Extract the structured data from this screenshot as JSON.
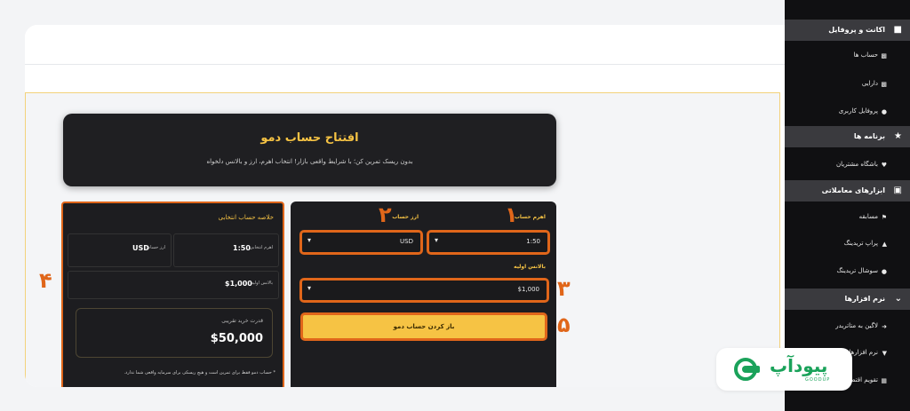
{
  "hero": {
    "title": "افتتاح حساب دمو",
    "subtitle": "بدون ریسک تمرین کن؛ با شرایط واقعی بازار! انتخاب اهرم، ارز و بالانس دلخواه"
  },
  "form": {
    "leverage_label": "اهرم حساب",
    "leverage_value": "1:50",
    "currency_label": "ارز حساب",
    "currency_value": "USD",
    "balance_label": "بالانس اولیه",
    "balance_value": "$1,000",
    "submit_label": "باز کردن حساب دمو"
  },
  "summary": {
    "title": "خلاصه حساب انتخابی",
    "leverage_label": "اهرم انتخابی",
    "leverage_value": "1:50",
    "currency_label": "ارز حساب",
    "currency_value": "USD",
    "balance_label": "بالانس اولیه",
    "balance_value": "$1,000",
    "buying_power_label": "قدرت خرید تقریبی",
    "buying_power_value": "$50,000",
    "note": "* حساب دمو فقط برای تمرین است و هیچ ریسکی برای سرمایه واقعی شما ندارد."
  },
  "annotations": {
    "n1": "۱",
    "n2": "۲",
    "n3": "۳",
    "n4": "۴",
    "n5": "۵"
  },
  "sidebar": {
    "sections": [
      {
        "title": "اکانت و پروفایل",
        "icon": "user-icon",
        "items": [
          {
            "label": "حساب ها",
            "icon": "wallet-icon"
          },
          {
            "label": "دارایی",
            "icon": "card-icon"
          },
          {
            "label": "پروفایل کاربری",
            "icon": "user-icon"
          }
        ]
      },
      {
        "title": "برنامه ها",
        "icon": "trophy-icon",
        "items": [
          {
            "label": "باشگاه مشتریان",
            "icon": "heart-icon"
          }
        ]
      },
      {
        "title": "ابزارهای معاملاتی",
        "icon": "briefcase-icon",
        "items": [
          {
            "label": "مسابقه",
            "icon": "flag-icon"
          },
          {
            "label": "پراپ تریدینگ",
            "icon": "chart-icon"
          },
          {
            "label": "سوشال تریدینگ",
            "icon": "users-icon"
          }
        ]
      },
      {
        "title": "نرم افزارها",
        "icon": "chevron-down-icon",
        "items": [
          {
            "label": "لاگین به متاتریدر",
            "icon": "login-icon"
          },
          {
            "label": "نرم افزارها",
            "icon": "download-icon"
          },
          {
            "label": "تقویم اقتصادی",
            "icon": "calendar-icon"
          }
        ]
      }
    ]
  },
  "logo": {
    "wordmark": "پیودآپ",
    "subtext": "GOODUP",
    "color": "#1aa25a"
  },
  "colors": {
    "accent": "#f6c344",
    "highlight": "#e0661a",
    "panel": "#1d1d20",
    "sidebar": "#101012"
  }
}
